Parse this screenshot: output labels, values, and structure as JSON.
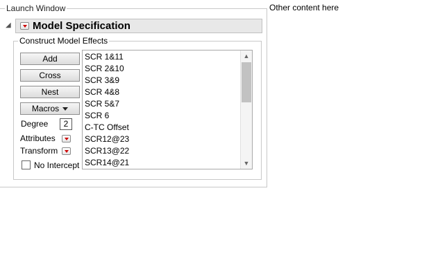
{
  "launch_window": {
    "title": "Launch Window"
  },
  "other_content": "Other content here",
  "model_spec": {
    "title": "Model Specification"
  },
  "construct_effects": {
    "title": "Construct Model Effects",
    "buttons": {
      "add": "Add",
      "cross": "Cross",
      "nest": "Nest",
      "macros": "Macros"
    },
    "degree_label": "Degree",
    "degree_value": "2",
    "attributes_label": "Attributes",
    "transform_label": "Transform",
    "no_intercept_label": "No Intercept",
    "no_intercept_checked": false
  },
  "effects_list": [
    "SCR 1&11",
    "SCR 2&10",
    "SCR 3&9",
    "SCR 4&8",
    "SCR 5&7",
    "SCR 6",
    "C-TC Offset",
    "SCR12@23",
    "SCR13@22",
    "SCR14@21"
  ],
  "colors": {
    "menu_triangle": "#cc0000",
    "header_bg": "#e8e8e8"
  }
}
